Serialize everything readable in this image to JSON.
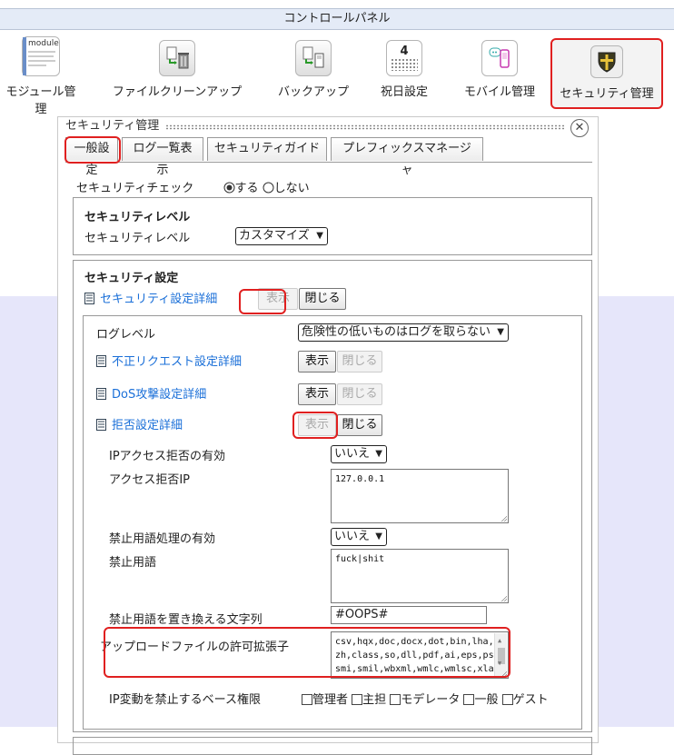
{
  "header": {
    "title": "コントロールパネル"
  },
  "toolbar": {
    "items": [
      {
        "label": "モジュール管理",
        "icon": "module-icon",
        "icon_text": "module"
      },
      {
        "label": "ファイルクリーンアップ",
        "icon": "file-cleanup-icon"
      },
      {
        "label": "バックアップ",
        "icon": "backup-icon"
      },
      {
        "label": "祝日設定",
        "icon": "calendar-icon",
        "icon_text": "4"
      },
      {
        "label": "モバイル管理",
        "icon": "mobile-icon"
      },
      {
        "label": "セキュリティ管理",
        "icon": "shield-icon"
      }
    ],
    "active_index": 5
  },
  "panel": {
    "title": "セキュリティ管理",
    "close_glyph": "✕",
    "tabs": [
      {
        "label": "一般設定",
        "active": true
      },
      {
        "label": "ログ一覧表示"
      },
      {
        "label": "セキュリティガイド"
      },
      {
        "label": "プレフィックスマネージャ"
      }
    ],
    "security_check": {
      "label": "セキュリティチェック",
      "options": [
        "する",
        "しない"
      ],
      "selected": "する"
    },
    "security_level": {
      "heading": "セキュリティレベル",
      "label": "セキュリティレベル",
      "value": "カスタマイズ"
    },
    "security_settings": {
      "heading": "セキュリティ設定",
      "detail_link": "セキュリティ設定詳細",
      "show_label": "表示",
      "close_label": "閉じる"
    },
    "detail": {
      "log_level": {
        "label": "ログレベル",
        "value": "危険性の低いものはログを取らない"
      },
      "invalid_request": {
        "label": "不正リクエスト設定詳細",
        "show": "表示",
        "close": "閉じる"
      },
      "dos": {
        "label": "DoS攻撃設定詳細",
        "show": "表示",
        "close": "閉じる"
      },
      "deny": {
        "label": "拒否設定詳細",
        "show": "表示",
        "close": "閉じる"
      },
      "ip_deny_enabled": {
        "label": "IPアクセス拒否の有効",
        "value": "いいえ"
      },
      "deny_ip": {
        "label": "アクセス拒否IP",
        "value": "127.0.0.1"
      },
      "banned_words_enabled": {
        "label": "禁止用語処理の有効",
        "value": "いいえ"
      },
      "banned_words": {
        "label": "禁止用語",
        "value": "fuck|shit"
      },
      "replace_string": {
        "label": "禁止用語を置き換える文字列",
        "value": "#OOPS#"
      },
      "allowed_ext": {
        "label": "アップロードファイルの許可拡張子",
        "lines": [
          "csv,hqx,doc,docx,dot,bin,lha,l",
          "zh,class,so,dll,pdf,ai,eps,ps,",
          "smi,smil,wbxml,wmlc,wmlsc,xla,"
        ]
      },
      "ip_change_base": {
        "label": "IP変動を禁止するベース権限",
        "options": [
          "管理者",
          "主担",
          "モデレータ",
          "一般",
          "ゲスト"
        ]
      }
    }
  },
  "colors": {
    "accent_red": "#e02020",
    "link": "#1a6fd8",
    "lavender": "#e6e6fa",
    "header_bg": "#e4ebf7"
  }
}
